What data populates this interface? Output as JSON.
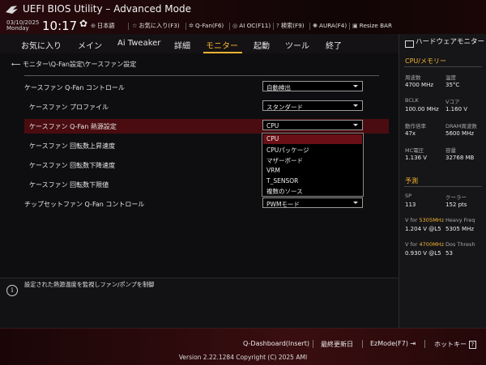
{
  "titlebar": {
    "title": "UEFI BIOS Utility – Advanced Mode",
    "date": "03/10/2025",
    "day": "Monday",
    "time": "10:17",
    "items": [
      {
        "icon": "globe-icon",
        "glyph": "⊕",
        "label": "日本語"
      },
      {
        "icon": "star-icon",
        "glyph": "☆",
        "label": "お気に入り(F3)"
      },
      {
        "icon": "fan-icon",
        "glyph": "✲",
        "label": "Q-Fan(F6)"
      },
      {
        "icon": "ai-oc-icon",
        "glyph": "◎",
        "label": "AI OC(F11)"
      },
      {
        "icon": "help-icon",
        "glyph": "?",
        "label": "検索(F9)"
      },
      {
        "icon": "aura-icon",
        "glyph": "✺",
        "label": "AURA(F4)"
      },
      {
        "icon": "resize-icon",
        "glyph": "▣",
        "label": "Resize BAR"
      }
    ]
  },
  "menu": {
    "items": [
      "お気に入り",
      "メイン",
      "Ai Tweaker",
      "詳細",
      "モニター",
      "起動",
      "ツール",
      "終了"
    ],
    "active": "モニター"
  },
  "breadcrumb": "モニター\\Q-Fan設定\\ケースファン設定",
  "settings": [
    {
      "label": "ケースファン Q-Fan コントロール",
      "value": "自動検出",
      "dropdown": true
    },
    {
      "label": "ケースファン プロファイル",
      "value": "スタンダード",
      "dropdown": true
    },
    {
      "label": "ケースファン Q-Fan 熱源設定",
      "value": "CPU",
      "dropdown": true,
      "selected": true
    },
    {
      "label": "ケースファン 回転数上昇速度",
      "value": "",
      "dropdown": false
    },
    {
      "label": "ケースファン 回転数下降速度",
      "value": "",
      "dropdown": false
    },
    {
      "label": "ケースファン 回転数下限値",
      "value": "",
      "dropdown": false
    },
    {
      "label": "チップセットファン Q-Fan コントロール",
      "value": "PWMモード",
      "dropdown": true
    }
  ],
  "dropdown_options": {
    "options": [
      "CPU",
      "CPUパッケージ",
      "マザーボード",
      "VRM",
      "T_SENSOR",
      "複数のソース"
    ],
    "highlighted": "CPU"
  },
  "help": "設定された熱源温度を監視しファン/ポンプを制御",
  "hardware": {
    "title": "ハードウェアモニター",
    "cpu_section": "CPU/メモリー",
    "stats": [
      {
        "label": "周波数",
        "value": "4700 MHz"
      },
      {
        "label": "温度",
        "value": "35°C"
      },
      {
        "label": "BCLK",
        "value": "100.00 MHz"
      },
      {
        "label": "Vコア",
        "value": "1.160 V"
      },
      {
        "label": "動作倍率",
        "value": "47x"
      },
      {
        "label": "DRAM周波数",
        "value": "5600 MHz"
      },
      {
        "label": "MC電圧",
        "value": "1.136 V"
      },
      {
        "label": "容量",
        "value": "32768 MB"
      }
    ],
    "predict_section": "予測",
    "predict": [
      {
        "label": "SP",
        "value": "113"
      },
      {
        "label": "クーラー",
        "value": "152 pts"
      },
      {
        "label_prefix": "V for ",
        "label_freq": "5305MHz",
        "value": "1.204 V @L5"
      },
      {
        "label": "Heavy Freq",
        "value": "5305 MHz"
      },
      {
        "label_prefix": "V for ",
        "label_freq": "4700MHz",
        "value": "0.930 V @L5"
      },
      {
        "label": "Dos Thresh",
        "value": "53"
      }
    ]
  },
  "footer": {
    "items": [
      "Q-Dashboard(Insert)",
      "最終更新日",
      "EzMode(F7)",
      "ホットキー"
    ],
    "version": "Version 2.22.1284 Copyright (C) 2025 AMI"
  },
  "colors": {
    "accent": "#f5b432",
    "selected_row": "#4a0c10",
    "highlight_option": "#6a0f15"
  }
}
